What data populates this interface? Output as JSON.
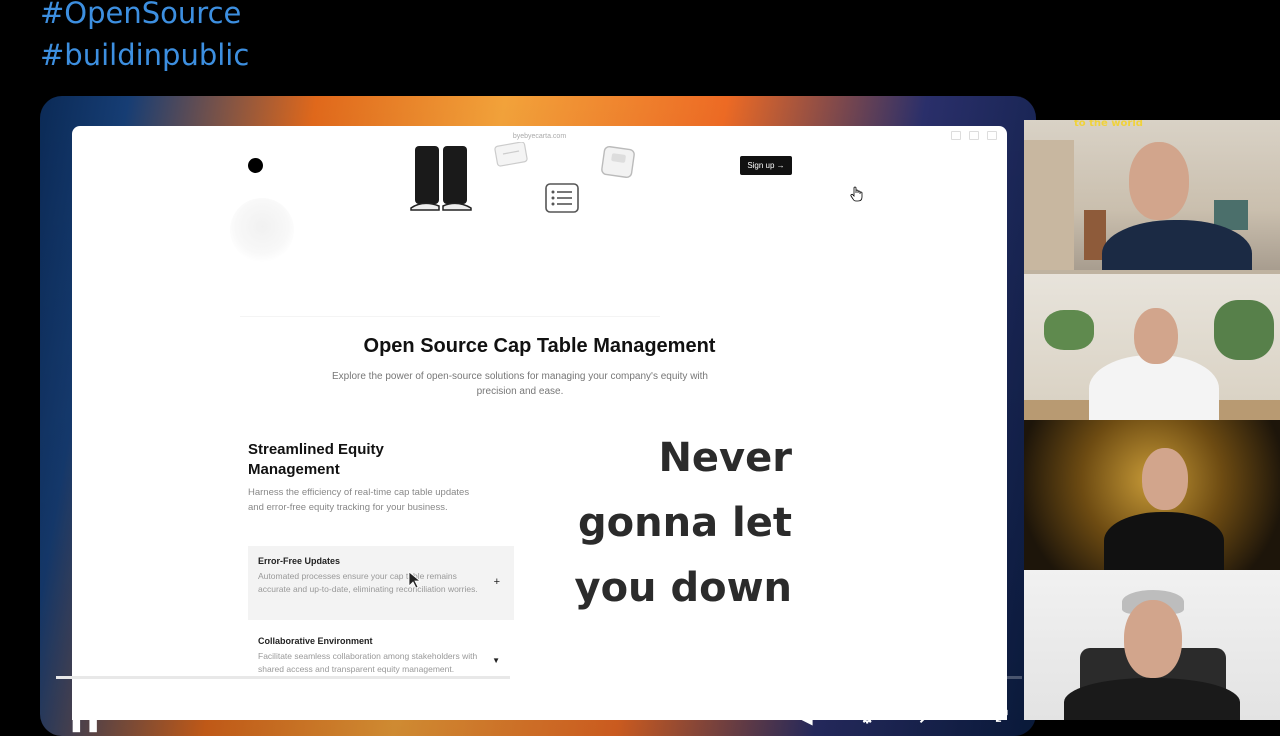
{
  "hashtags": [
    "#OpenSource",
    "#buildinpublic"
  ],
  "browser": {
    "url": "byebyecarta.com"
  },
  "site": {
    "signup_label": "Sign up →",
    "hero_title": "Open Source Cap Table Management",
    "hero_subtitle": "Explore the power of open-source solutions for managing your company's equity with precision and ease.",
    "section_title": "Streamlined Equity Management",
    "section_desc": "Harness the efficiency of real-time cap table updates and error-free equity tracking for your business.",
    "features": [
      {
        "title": "Error-Free Updates",
        "desc": "Automated processes ensure your cap table remains accurate and up-to-date, eliminating reconciliation worries."
      },
      {
        "title": "Collaborative Environment",
        "desc": "Facilitate seamless collaboration among stakeholders with shared access and transparent equity management."
      }
    ],
    "lyric_lines": [
      "Never",
      "gonna let",
      "you down"
    ]
  },
  "video": {
    "progress_percent": 47
  },
  "participants": [
    {
      "name": "participant-1",
      "label": "to the world"
    },
    {
      "name": "participant-2"
    },
    {
      "name": "participant-3"
    },
    {
      "name": "participant-4"
    }
  ],
  "colors": {
    "hashtag": "#3d8fe0",
    "signup_bg": "#111111",
    "feature_active_bg": "#f3f3f3"
  }
}
